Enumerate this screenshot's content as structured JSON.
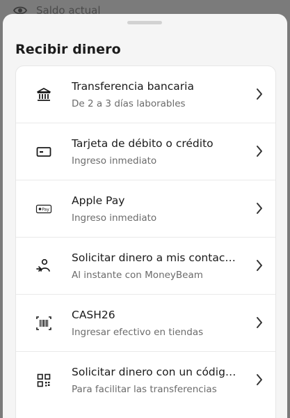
{
  "background": {
    "label": "Saldo actual"
  },
  "sheet": {
    "title": "Recibir dinero",
    "items": [
      {
        "title": "Transferencia bancaria",
        "subtitle": "De 2 a 3 días laborables",
        "icon": "bank-icon"
      },
      {
        "title": "Tarjeta de débito o crédito",
        "subtitle": "Ingreso inmediato",
        "icon": "card-icon"
      },
      {
        "title": "Apple Pay",
        "subtitle": "Ingreso inmediato",
        "icon": "apple-pay-icon",
        "icon_text": "Pay"
      },
      {
        "title": "Solicitar dinero a mis contactos",
        "subtitle": "Al instante con MoneyBeam",
        "icon": "contact-request-icon"
      },
      {
        "title": "CASH26",
        "subtitle": "Ingresar efectivo en tiendas",
        "icon": "barcode-icon"
      },
      {
        "title": "Solicitar dinero con un código QR",
        "subtitle": "Para facilitar las transferencias",
        "icon": "qr-code-icon"
      }
    ]
  },
  "colors": {
    "overlay": "#7b7b7b",
    "sheet_bg": "#f5f5f5",
    "card_bg": "#ffffff",
    "title_text": "#1a1a1a",
    "subtitle_text": "#6b6b6b"
  }
}
